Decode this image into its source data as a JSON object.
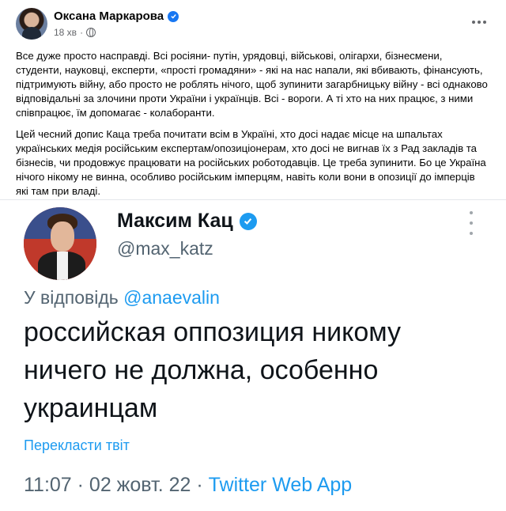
{
  "post": {
    "author": "Оксана Маркарова",
    "time": "18 хв",
    "paragraph1": "Все дуже просто насправді. Всі росіяни- путін, урядовці, військові, олігархи, бізнесмени, студенти, науковці, експерти, «прості громадяни» - які на нас напали, які вбивають, фінансують, підтримують війну, або просто не роблять нічого, щоб зупинити загарбницьку війну - всі однаково відповідальні за злочини проти України і українців. Всі - вороги. А ті хто на них працює, з ними співпрацює, їм допомагає - колаборанти.",
    "paragraph2": "Цей чесний допис Каца треба почитати всім в Україні, хто досі надає місце на шпальтах українських медія російським експертам/опозиціонерам, хто досі не вигнав їх з Рад закладів та бізнесів, чи продовжує  працювати на російських роботодавців. Це треба зупинити. Бо це Україна нічого нікому не винна, особливо російським імперцям, навіть коли вони в опозиції до імперців які там при владі."
  },
  "tweet": {
    "name": "Максим Кац",
    "handle": "@max_katz",
    "reply_prefix": "У відповідь ",
    "reply_mention": "@anaevalin",
    "text": "российская оппозиция никому ничего не должна, особенно украинцам",
    "translate": "Перекласти твіт",
    "timestamp": "11:07 · 02 жовт. 22 · ",
    "app": "Twitter Web App"
  },
  "colors": {
    "facebook_verified": "#1877f2",
    "twitter_blue": "#1d9bf0",
    "muted_text": "#536471"
  },
  "icons": [
    "verified-badge-icon",
    "globe-icon",
    "more-options-icon"
  ]
}
